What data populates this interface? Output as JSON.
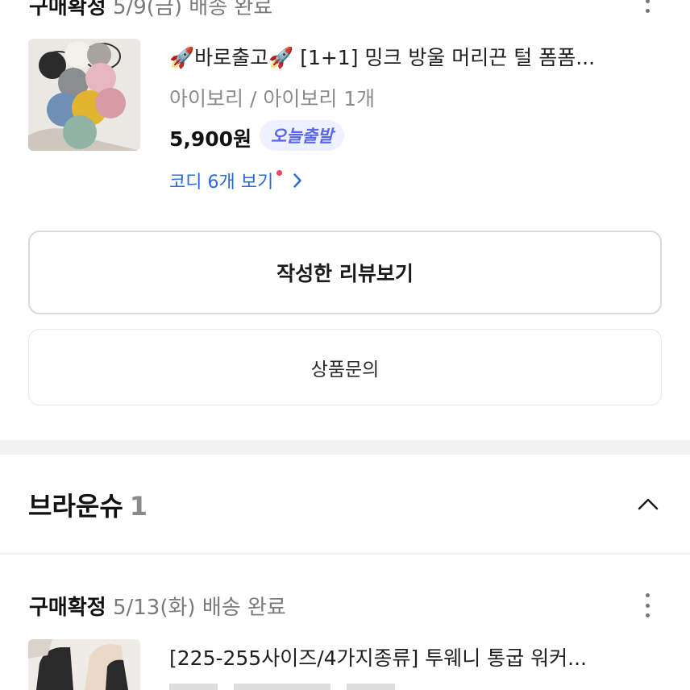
{
  "order1": {
    "status": "구매확정",
    "date": "5/9(금)",
    "delivery": "배송 완료",
    "product_name": "🚀바로출고🚀 [1+1] 밍크 방울 머리끈 털 폼폼...",
    "option": "아이보리 / 아이보리 1개",
    "price": "5,900원",
    "badge": "오늘출발",
    "coordi_link": "코디 6개 보기",
    "review_button": "작성한 리뷰보기",
    "inquiry_button": "상품문의"
  },
  "section": {
    "title": "브라운슈",
    "count": "1"
  },
  "order2": {
    "status": "구매확정",
    "date": "5/13(화)",
    "delivery": "배송 완료",
    "product_name": "[225-255사이즈/4가지종류] 투웨니 통굽 워커..."
  },
  "icons": {
    "more": "more-vertical-icon",
    "chevron_right": "chevron-right-icon",
    "chevron_up": "chevron-up-icon"
  },
  "colors": {
    "link_blue": "#2a6bd6",
    "badge_bg": "#eef1ff",
    "badge_text": "#5a67e8",
    "notice_red": "#f0445a"
  }
}
